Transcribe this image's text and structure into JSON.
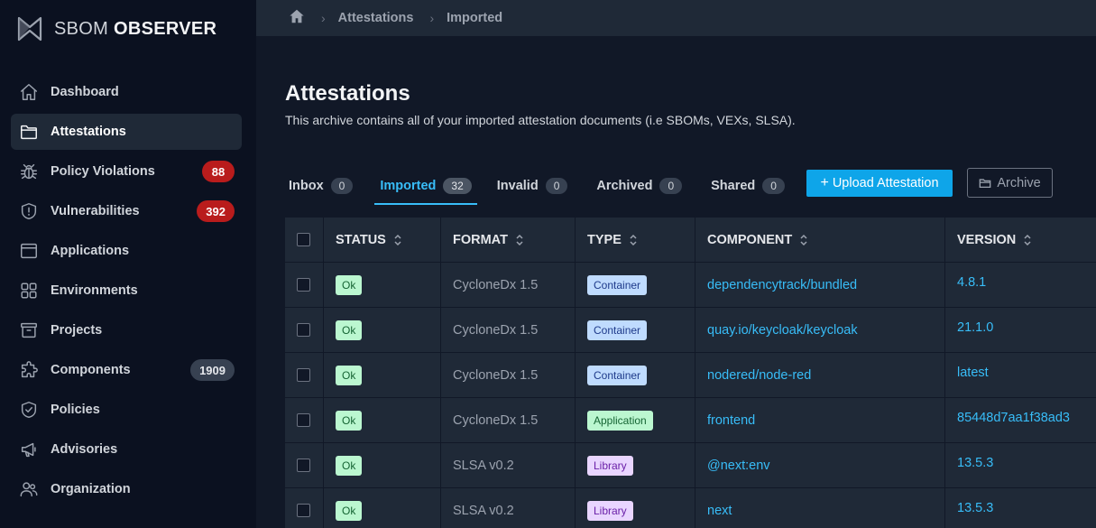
{
  "app": {
    "name_part1": "SBOM",
    "name_part2": "OBSERVER"
  },
  "sidebar": {
    "items": [
      {
        "label": "Dashboard",
        "icon": "home-icon"
      },
      {
        "label": "Attestations",
        "icon": "folder-icon",
        "active": true
      },
      {
        "label": "Policy Violations",
        "icon": "bug-icon",
        "badge": "88",
        "badge_color": "#b91c1c"
      },
      {
        "label": "Vulnerabilities",
        "icon": "shield-exclamation-icon",
        "badge": "392",
        "badge_color": "#b91c1c"
      },
      {
        "label": "Applications",
        "icon": "window-icon"
      },
      {
        "label": "Environments",
        "icon": "grid-icon"
      },
      {
        "label": "Projects",
        "icon": "archive-box-icon"
      },
      {
        "label": "Components",
        "icon": "puzzle-icon",
        "badge": "1909",
        "badge_color": "#374151"
      },
      {
        "label": "Policies",
        "icon": "shield-check-icon"
      },
      {
        "label": "Advisories",
        "icon": "megaphone-icon"
      },
      {
        "label": "Organization",
        "icon": "users-icon"
      }
    ]
  },
  "breadcrumb": {
    "items": [
      "Attestations",
      "Imported"
    ]
  },
  "page": {
    "title": "Attestations",
    "description": "This archive contains all of your imported attestation documents (i.e SBOMs, VEXs, SLSA)."
  },
  "tabs": [
    {
      "label": "Inbox",
      "count": "0"
    },
    {
      "label": "Imported",
      "count": "32",
      "active": true
    },
    {
      "label": "Invalid",
      "count": "0"
    },
    {
      "label": "Archived",
      "count": "0"
    },
    {
      "label": "Shared",
      "count": "0"
    }
  ],
  "actions": {
    "upload_label": "Upload Attestation",
    "archive_label": "Archive"
  },
  "table": {
    "headers": [
      "STATUS",
      "FORMAT",
      "TYPE",
      "COMPONENT",
      "VERSION"
    ],
    "rows": [
      {
        "status": "Ok",
        "format": "CycloneDx 1.5",
        "type": "Container",
        "component": "dependencytrack/bundled",
        "version": "4.8.1"
      },
      {
        "status": "Ok",
        "format": "CycloneDx 1.5",
        "type": "Container",
        "component": "quay.io/keycloak/keycloak",
        "version": "21.1.0"
      },
      {
        "status": "Ok",
        "format": "CycloneDx 1.5",
        "type": "Container",
        "component": "nodered/node-red",
        "version": "latest"
      },
      {
        "status": "Ok",
        "format": "CycloneDx 1.5",
        "type": "Application",
        "component": "frontend",
        "version": "85448d7aa1f38ad3"
      },
      {
        "status": "Ok",
        "format": "SLSA v0.2",
        "type": "Library",
        "component": "@next:env",
        "version": "13.5.3"
      },
      {
        "status": "Ok",
        "format": "SLSA v0.2",
        "type": "Library",
        "component": "next",
        "version": "13.5.3"
      }
    ]
  },
  "colors": {
    "accent": "#38bdf8",
    "primary_button": "#0ea5e9",
    "sidebar_bg": "#0b1120",
    "content_bg": "#111827"
  }
}
